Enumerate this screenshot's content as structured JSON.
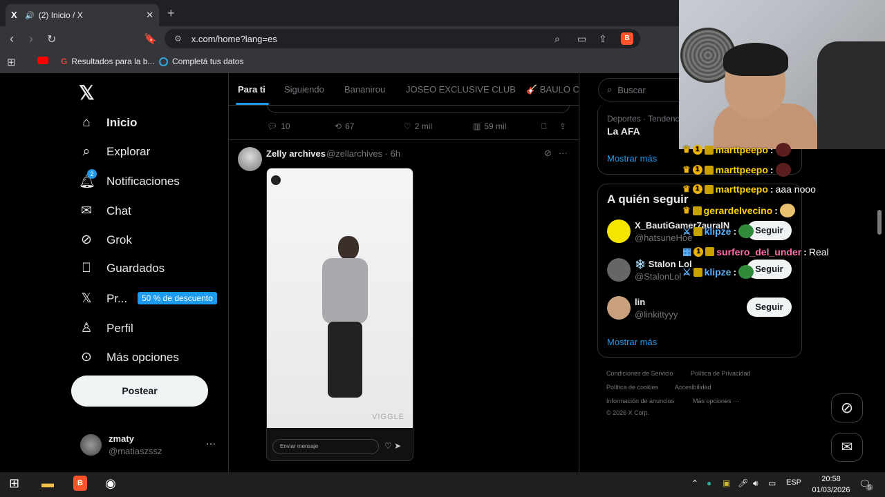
{
  "browser": {
    "tab_title": "(2) Inicio / X",
    "tab_fav": "X",
    "url": "x.com/home?lang=es",
    "bookmarks": [
      "Resultados para la b...",
      "Completá tus datos"
    ]
  },
  "nav": {
    "items": [
      {
        "label": "Inicio",
        "icon": "home-icon"
      },
      {
        "label": "Explorar",
        "icon": "search-icon"
      },
      {
        "label": "Notificaciones",
        "icon": "bell-icon"
      },
      {
        "label": "Chat",
        "icon": "mail-icon"
      },
      {
        "label": "Grok",
        "icon": "grok-icon"
      },
      {
        "label": "Guardados",
        "icon": "bookmark-icon"
      },
      {
        "label": "Pr...",
        "icon": "x-logo-icon"
      },
      {
        "label": "Perfil",
        "icon": "person-icon"
      },
      {
        "label": "Más opciones",
        "icon": "more-circle-icon"
      }
    ],
    "notif_count": "2",
    "promo": "50 % de descuento",
    "post_button": "Postear",
    "account": {
      "name": "zmaty",
      "handle": "@matiaszssz"
    }
  },
  "timeline": {
    "tabs": [
      "Para ti",
      "Siguiendo",
      "Bananirou",
      "JOSEO EXCLUSIVE CLUB",
      "🎸 BAULO CL"
    ],
    "prev_actions": {
      "replies": "10",
      "reposts": "67",
      "likes": "2 mil",
      "views": "59 mil"
    },
    "tweet": {
      "name": "Zelly archives",
      "meta": "@zellarchives · 6h",
      "media_watermark": "VIGGLE",
      "dm_placeholder": "Enviar mensaje"
    }
  },
  "sidebar": {
    "search_placeholder": "Buscar",
    "trend": {
      "meta": "Deportes · Tendencia",
      "name": "La AFA"
    },
    "show_more": "Mostrar más",
    "who_to_follow_title": "A quién seguir",
    "suggestions": [
      {
        "name": "X_BautiGamer7auraIN",
        "handle": "@hatsuneHoe",
        "avatar_color": "#f5e600"
      },
      {
        "name": "❄️ Stalon Lol",
        "handle": "@StalonLol",
        "avatar_color": "#666666"
      },
      {
        "name": "lin",
        "handle": "@linkittyyy",
        "avatar_color": "#c9a07e"
      }
    ],
    "follow_label": "Seguir",
    "footer": [
      "Condiciones de Servicio",
      "Política de Privacidad",
      "Política de cookies",
      "Accesibilidad",
      "Información de anuncios",
      "Más opciones ···",
      "© 2026 X Corp."
    ]
  },
  "stream_chat": [
    {
      "user": "marttpeepo",
      "color": "#ffd200",
      "msg": ""
    },
    {
      "user": "marttpeepo",
      "color": "#ffd200",
      "msg": ""
    },
    {
      "user": "marttpeepo",
      "color": "#ffd200",
      "msg": "aaa nooo"
    },
    {
      "user": "gerardelvecino",
      "color": "#ffd200",
      "msg": ""
    },
    {
      "user": "klipze",
      "color": "#5ab0ff",
      "msg": ""
    },
    {
      "user": "surfero_del_under",
      "color": "#ff6fa8",
      "msg": "Real"
    },
    {
      "user": "klipze",
      "color": "#5ab0ff",
      "msg": ""
    }
  ],
  "taskbar": {
    "lang": "ESP",
    "time": "20:58",
    "date": "01/03/2026",
    "notif": "5"
  },
  "colors": {
    "accent": "#1d9bf0",
    "background": "#000000",
    "brave": "#fb542b"
  }
}
